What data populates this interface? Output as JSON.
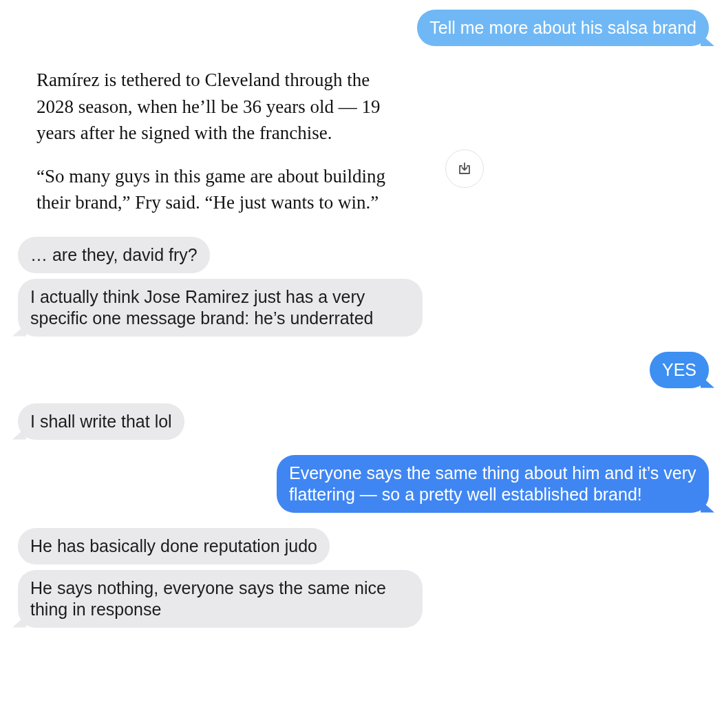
{
  "messages": [
    {
      "kind": "sent",
      "text": "Tell me more about his salsa brand",
      "color": "#6fb8f5",
      "tail": true
    },
    {
      "kind": "article",
      "paragraphs": [
        "Ramírez is tethered to Cleveland through the 2028 season, when he’ll be 36 years old — 19 years after he signed with the franchise.",
        "“So many guys in this game are about building their brand,” Fry said. “He just wants to win.”"
      ]
    },
    {
      "kind": "received",
      "text": "… are they, david fry?",
      "tail": false
    },
    {
      "kind": "received",
      "text": "I actually think Jose Ramirez just has a very specific one message brand: he’s underrated",
      "tail": true
    },
    {
      "kind": "sent",
      "text": "YES",
      "color": "#3d8ff1",
      "tail": true
    },
    {
      "kind": "received",
      "text": "I shall write that lol",
      "tail": true
    },
    {
      "kind": "sent",
      "text": "Everyone says the same thing about him and it’s very flattering — so a pretty well established brand!",
      "color": "#3f86f3",
      "tail": true
    },
    {
      "kind": "received",
      "text": "He has basically done reputation judo",
      "tail": false
    },
    {
      "kind": "received",
      "text": "He says nothing, everyone says the same nice thing in response",
      "tail": true
    }
  ]
}
